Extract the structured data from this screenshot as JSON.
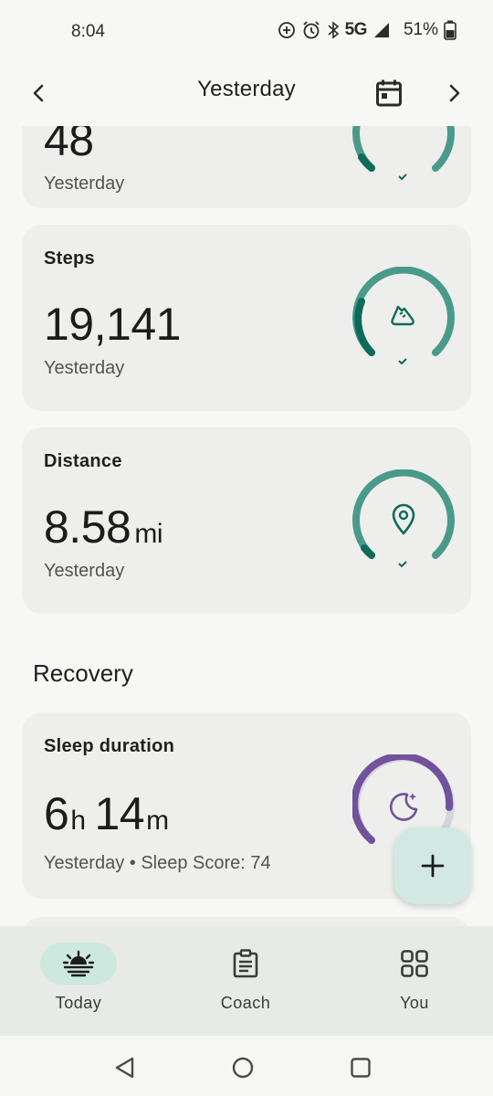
{
  "status_bar": {
    "time": "8:04",
    "network": "5G",
    "battery_percent": "51%"
  },
  "header": {
    "title": "Yesterday"
  },
  "cards": {
    "top_partial": {
      "value": "48",
      "sub": "Yesterday"
    },
    "steps": {
      "label": "Steps",
      "value": "19,141",
      "sub": "Yesterday",
      "icon": "shoe-icon",
      "progress": 0.75
    },
    "distance": {
      "label": "Distance",
      "value": "8.58",
      "unit": "mi",
      "sub": "Yesterday",
      "icon": "location-pin-icon",
      "progress": 0.75
    },
    "sleep": {
      "label": "Sleep duration",
      "hours": "6",
      "hours_unit": "h",
      "minutes": "14",
      "minutes_unit": "m",
      "sub": "Yesterday • Sleep Score: 74",
      "icon": "moon-icon",
      "progress": 0.55
    }
  },
  "section": {
    "recovery_title": "Recovery"
  },
  "nav": {
    "today": "Today",
    "coach": "Coach",
    "you": "You"
  },
  "colors": {
    "teal_ring": "#4a9a8c",
    "teal_dark": "#0d6b5a",
    "purple_ring": "#72529c",
    "nav_active": "#cde8df",
    "fab": "#d2e9e3"
  }
}
